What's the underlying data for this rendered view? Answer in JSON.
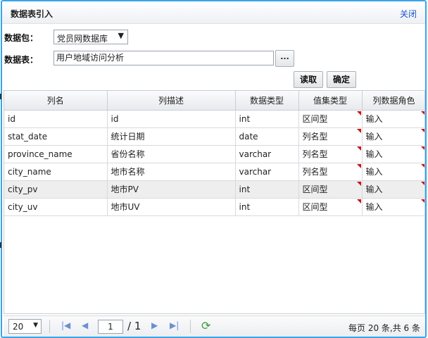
{
  "dialog": {
    "title": "数据表引入",
    "close_label": "关闭"
  },
  "form": {
    "package_label": "数据包：",
    "package_value": "党员网数据库",
    "table_label": "数据表：",
    "table_value": "用户地域访问分析",
    "browse_label": "..."
  },
  "actions": {
    "read_label": "读取",
    "confirm_label": "确定"
  },
  "grid": {
    "columns": [
      "列名",
      "列描述",
      "数据类型",
      "值集类型",
      "列数据角色"
    ],
    "rows": [
      {
        "name": "id",
        "desc": "id",
        "type": "int",
        "set_type": "区间型",
        "role": "输入"
      },
      {
        "name": "stat_date",
        "desc": "统计日期",
        "type": "date",
        "set_type": "列名型",
        "role": "输入"
      },
      {
        "name": "province_name",
        "desc": "省份名称",
        "type": "varchar",
        "set_type": "列名型",
        "role": "输入"
      },
      {
        "name": "city_name",
        "desc": "地市名称",
        "type": "varchar",
        "set_type": "列名型",
        "role": "输入"
      },
      {
        "name": "city_pv",
        "desc": "地市PV",
        "type": "int",
        "set_type": "区间型",
        "role": "输入"
      },
      {
        "name": "city_uv",
        "desc": "地市UV",
        "type": "int",
        "set_type": "区间型",
        "role": "输入"
      }
    ],
    "selected_row": 4
  },
  "pager": {
    "page_size": "20",
    "current_page": "1",
    "total_pages": "/ 1",
    "info": "每页 20 条,共 6 条"
  },
  "colors": {
    "border_accent": "#38a4ea",
    "link": "#1a55c8",
    "dirty_marker": "#cc1111",
    "refresh": "#3d9a3d"
  }
}
